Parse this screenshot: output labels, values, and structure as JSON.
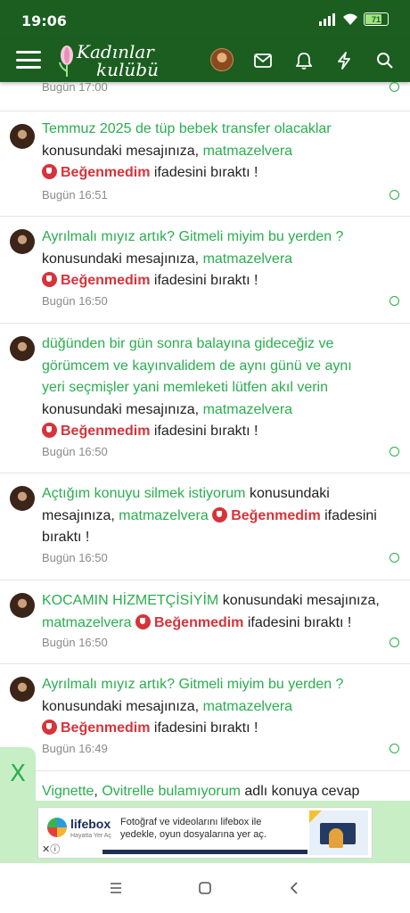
{
  "status_bar": {
    "time": "19:06",
    "battery": "71"
  },
  "app_bar": {
    "logo_line1": "Kadınlar",
    "logo_line2": "kulübü"
  },
  "first_partial_time": "Bugün 17:00",
  "notifications": [
    {
      "topic": "Temmuz 2025 de tüp bebek transfer olacaklar",
      "middle": "konusundaki mesajınıza,",
      "user": "matmazelvera",
      "reaction": "Beğenmedim",
      "end": "ifadesini bıraktı !",
      "time": "Bugün 16:51"
    },
    {
      "topic": "Ayrılmalı mıyız artık? Gitmeli miyim bu yerden ?",
      "middle": "konusundaki mesajınıza,",
      "user": "matmazelvera",
      "reaction": "Beğenmedim",
      "end": "ifadesini bıraktı !",
      "time": "Bugün 16:50"
    },
    {
      "topic_lines": [
        "düğünden bir gün sonra balayına gideceğiz ve",
        "görümcem ve kayınvalidem de aynı günü ve aynı",
        "yeri seçmişler yani memleketi lütfen akıl verin"
      ],
      "middle": "konusundaki mesajınıza,",
      "user": "matmazelvera",
      "reaction": "Beğenmedim",
      "end": "ifadesini bıraktı !",
      "time": "Bugün 16:50"
    },
    {
      "topic": "Açtığım konuyu silmek istiyorum",
      "middle_a": "konusundaki",
      "middle_b": "mesajınıza,",
      "user": "matmazelvera",
      "reaction": "Beğenmedim",
      "end_a": "ifadesini",
      "end_b": "bıraktı !",
      "time": "Bugün 16:50"
    },
    {
      "topic": "KOCAMIN HİZMETÇİSİYİM",
      "middle": "konusundaki mesajınıza,",
      "user": "matmazelvera",
      "reaction": "Beğenmedim",
      "end": "ifadesini bıraktı !",
      "time": "Bugün 16:50"
    },
    {
      "topic": "Ayrılmalı mıyız artık? Gitmeli miyim bu yerden ?",
      "middle": "konusundaki mesajınıza,",
      "user": "matmazelvera",
      "reaction": "Beğenmedim",
      "end": "ifadesini bıraktı !",
      "time": "Bugün 16:49"
    }
  ],
  "last_partial": {
    "user": "Vignette",
    "sep": ",",
    "topic": "Ovitrelle bulamıyorum",
    "end": "adlı konuya cevap"
  },
  "ad": {
    "close_label": "X",
    "brand": "lifebox",
    "brand_sub": "Hayatta Yer Aç",
    "text": "Fotoğraf ve videolarını lifebox ile yedekle, oyun dosyalarına yer aç.",
    "info_label": "✕ⓘ"
  },
  "colors": {
    "header_green": "#1b5e20",
    "link_green": "#2aae4e",
    "reaction_red": "#d7333a",
    "ad_background": "#c7eec5"
  },
  "icons": [
    "hamburger-menu-icon",
    "envelope-icon",
    "bell-icon",
    "lightning-icon",
    "search-icon",
    "thumbs-down-icon",
    "recents-icon",
    "home-icon",
    "back-icon"
  ]
}
